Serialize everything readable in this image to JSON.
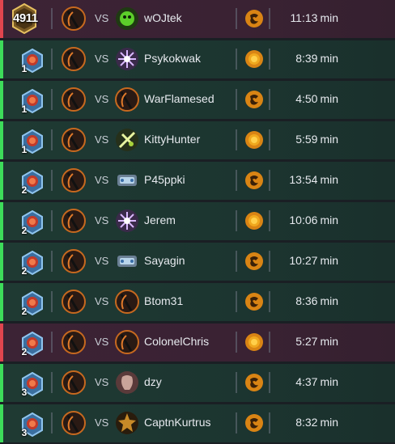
{
  "vs_label": "VS",
  "colors": {
    "win": "#3ddc5a",
    "loss": "#e0454e",
    "text": "#e6e9ee"
  },
  "games": [
    {
      "result": "loss",
      "rank_type": "legend",
      "rank": "4911",
      "hero_icon": "rogue-hero-icon",
      "opponent_icon": "demon-hunter-hero-icon",
      "opponent": "wOJtek",
      "mode_icon": "standard-mode-icon",
      "duration": "11:13",
      "unit": "min"
    },
    {
      "result": "win",
      "rank_type": "rank",
      "rank": "1",
      "hero_icon": "rogue-hero-icon",
      "opponent_icon": "mage-hero-icon",
      "opponent": "Psykokwak",
      "mode_icon": "wild-mode-icon",
      "duration": "8:39",
      "unit": "min"
    },
    {
      "result": "win",
      "rank_type": "rank",
      "rank": "1",
      "hero_icon": "rogue-hero-icon",
      "opponent_icon": "rogue-hero-icon",
      "opponent": "WarFlamesed",
      "mode_icon": "standard-mode-icon",
      "duration": "4:50",
      "unit": "min"
    },
    {
      "result": "win",
      "rank_type": "rank",
      "rank": "1",
      "hero_icon": "rogue-hero-icon",
      "opponent_icon": "hunter-hero-icon",
      "opponent": "KittyHunter",
      "mode_icon": "wild-mode-icon",
      "duration": "5:59",
      "unit": "min"
    },
    {
      "result": "win",
      "rank_type": "rank",
      "rank": "2",
      "hero_icon": "rogue-hero-icon",
      "opponent_icon": "shaman-hero-icon",
      "opponent": "P45ppki",
      "mode_icon": "standard-mode-icon",
      "duration": "13:54",
      "unit": "min"
    },
    {
      "result": "win",
      "rank_type": "rank",
      "rank": "2",
      "hero_icon": "rogue-hero-icon",
      "opponent_icon": "mage-hero-icon",
      "opponent": "Jerem",
      "mode_icon": "wild-mode-icon",
      "duration": "10:06",
      "unit": "min"
    },
    {
      "result": "win",
      "rank_type": "rank",
      "rank": "2",
      "hero_icon": "rogue-hero-icon",
      "opponent_icon": "shaman-hero-icon",
      "opponent": "Sayagin",
      "mode_icon": "standard-mode-icon",
      "duration": "10:27",
      "unit": "min"
    },
    {
      "result": "win",
      "rank_type": "rank",
      "rank": "2",
      "hero_icon": "rogue-hero-icon",
      "opponent_icon": "rogue-hero-icon",
      "opponent": "Btom31",
      "mode_icon": "standard-mode-icon",
      "duration": "8:36",
      "unit": "min"
    },
    {
      "result": "loss",
      "rank_type": "rank",
      "rank": "2",
      "hero_icon": "rogue-hero-icon",
      "opponent_icon": "rogue-hero-icon",
      "opponent": "ColonelChris",
      "mode_icon": "wild-mode-icon",
      "duration": "5:27",
      "unit": "min"
    },
    {
      "result": "win",
      "rank_type": "rank",
      "rank": "3",
      "hero_icon": "rogue-hero-icon",
      "opponent_icon": "druid-hero-icon",
      "opponent": "dzy",
      "mode_icon": "standard-mode-icon",
      "duration": "4:37",
      "unit": "min"
    },
    {
      "result": "win",
      "rank_type": "rank",
      "rank": "3",
      "hero_icon": "rogue-hero-icon",
      "opponent_icon": "warlock-hero-icon",
      "opponent": "CaptnKurtrus",
      "mode_icon": "standard-mode-icon",
      "duration": "8:32",
      "unit": "min"
    }
  ]
}
